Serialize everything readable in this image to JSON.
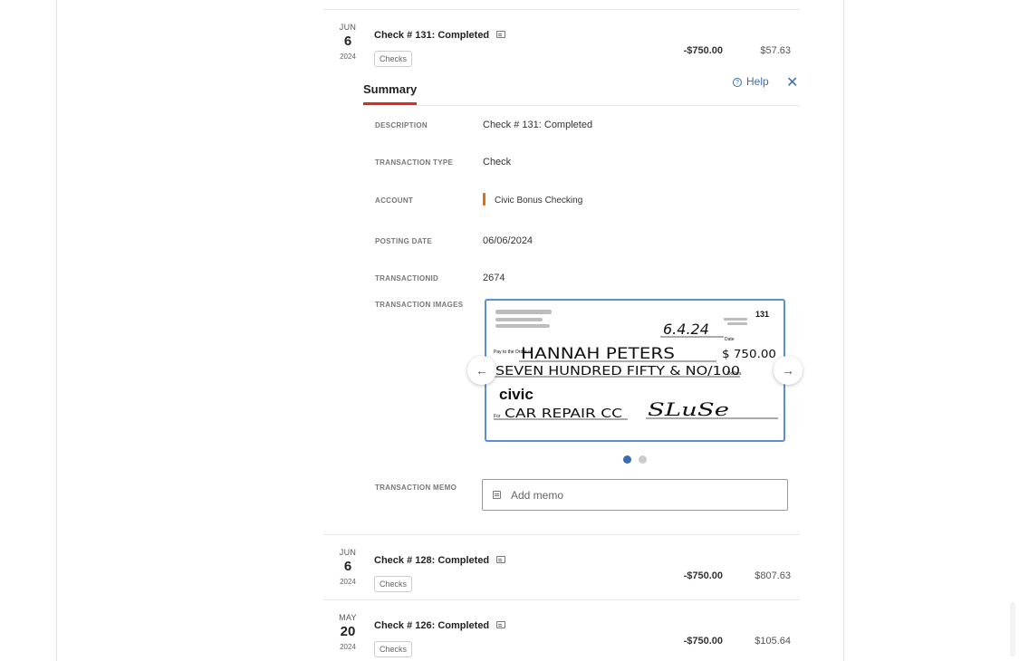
{
  "transactions": [
    {
      "month": "JUN",
      "day": "6",
      "year": "2024",
      "title": "Check # 131: Completed",
      "tag": "Checks",
      "amount": "-$750.00",
      "balance": "$57.63"
    },
    {
      "month": "JUN",
      "day": "6",
      "year": "2024",
      "title": "Check # 128: Completed",
      "tag": "Checks",
      "amount": "-$750.00",
      "balance": "$807.63"
    },
    {
      "month": "MAY",
      "day": "20",
      "year": "2024",
      "title": "Check # 126: Completed",
      "tag": "Checks",
      "amount": "-$750.00",
      "balance": "$105.64"
    }
  ],
  "summary": {
    "tab_label": "Summary",
    "help_label": "Help",
    "close_label": "✕",
    "fields": {
      "description": {
        "label": "DESCRIPTION",
        "value": "Check # 131: Completed"
      },
      "transaction_type": {
        "label": "TRANSACTION TYPE",
        "value": "Check"
      },
      "account": {
        "label": "ACCOUNT",
        "value": "Civic Bonus Checking",
        "color": "#e86b12"
      },
      "posting_date": {
        "label": "POSTING DATE",
        "value": "06/06/2024"
      },
      "transaction_id": {
        "label": "TRANSACTIONID",
        "value": "2674"
      },
      "transaction_images": {
        "label": "TRANSACTION IMAGES"
      },
      "transaction_memo": {
        "label": "TRANSACTION MEMO",
        "placeholder": "Add memo"
      }
    },
    "check_image": {
      "check_number": "131",
      "date": "6.4.24",
      "date_label": "Date",
      "pay_to_label": "Pay to the Order of",
      "payee": "HANNAH PETERS",
      "amount_numeric": "$ 750.00",
      "amount_words": "SEVEN HUNDRED FIFTY & NO/100",
      "dollars_label": "Dollars",
      "bank_logo": "civic",
      "for_label": "For",
      "memo": "CAR REPAIR CC",
      "signature": "SLuSe",
      "page_indicator": {
        "current": 1,
        "total": 2
      }
    }
  },
  "icons": {
    "image": "check-image-icon",
    "help": "help-circle-icon",
    "close": "close-icon",
    "prev": "arrow-left-icon",
    "next": "arrow-right-icon",
    "memo": "memo-icon"
  },
  "colors": {
    "accent_red": "#d62e1f",
    "link_blue": "#3a6cb3",
    "check_border": "#5b8fd6"
  }
}
